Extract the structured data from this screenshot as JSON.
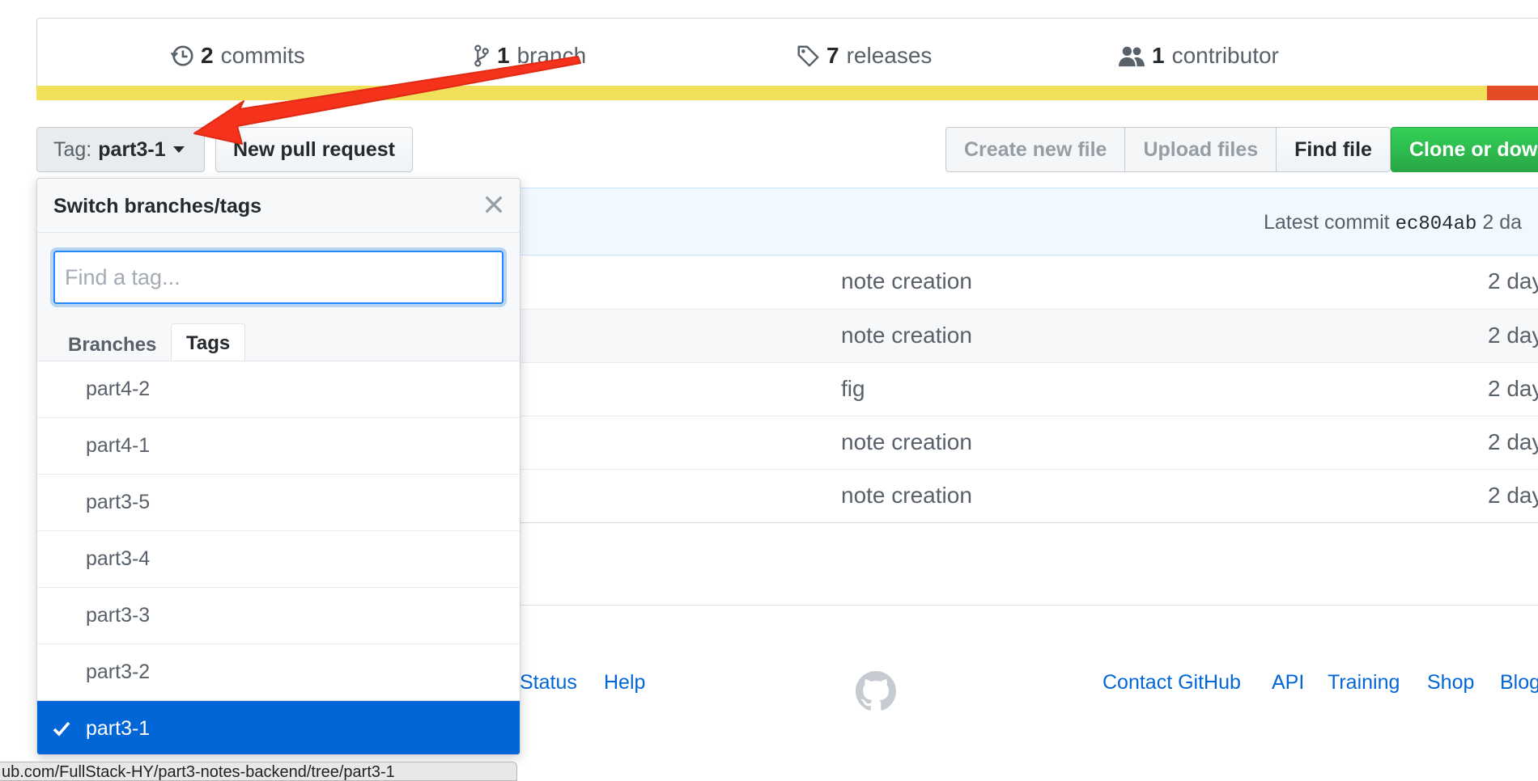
{
  "stats": {
    "commits": {
      "count": "2",
      "label": "commits"
    },
    "branches": {
      "count": "1",
      "label": "branch"
    },
    "releases": {
      "count": "7",
      "label": "releases"
    },
    "contributors": {
      "count": "1",
      "label": "contributor"
    }
  },
  "language_bar": {
    "colors": {
      "primary": "#f1e05a",
      "secondary": "#e34c26"
    }
  },
  "toolbar": {
    "select_prefix": "Tag:",
    "select_value": "part3-1",
    "new_pull_request": "New pull request",
    "create_new_file": "Create new file",
    "upload_files": "Upload files",
    "find_file": "Find file",
    "clone": "Clone or down"
  },
  "commit_bar": {
    "latest_label": "Latest commit",
    "sha": "ec804ab",
    "age": "2 da"
  },
  "files": [
    {
      "message": "note creation",
      "age": "2 day"
    },
    {
      "message": "note creation",
      "age": "2 day"
    },
    {
      "message": "fig",
      "age": "2 day"
    },
    {
      "message": "note creation",
      "age": "2 day"
    },
    {
      "message": "note creation",
      "age": "2 day"
    }
  ],
  "footer": {
    "status": "Status",
    "help": "Help",
    "contact": "Contact GitHub",
    "api": "API",
    "training": "Training",
    "shop": "Shop",
    "blog": "Blog"
  },
  "dropdown": {
    "title": "Switch branches/tags",
    "filter_placeholder": "Find a tag...",
    "tab_branches": "Branches",
    "tab_tags": "Tags",
    "tags": [
      "part4-2",
      "part4-1",
      "part3-5",
      "part3-4",
      "part3-3",
      "part3-2",
      "part3-1"
    ],
    "selected": "part3-1"
  },
  "status_url": "ub.com/FullStack-HY/part3-notes-backend/tree/part3-1",
  "annotation": {
    "color": "#f5331d"
  },
  "accent_colors": {
    "link": "#0366d6",
    "selected": "#0366d6",
    "clone": "#28a745"
  }
}
